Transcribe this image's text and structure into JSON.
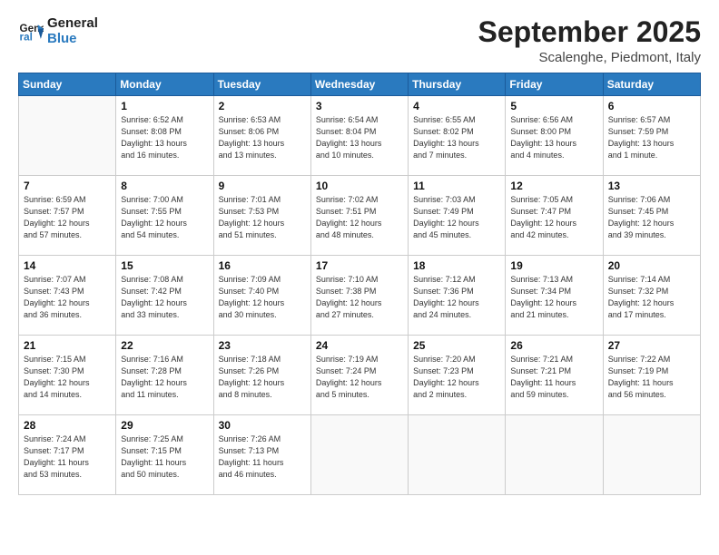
{
  "logo": {
    "line1": "General",
    "line2": "Blue"
  },
  "title": "September 2025",
  "location": "Scalenghe, Piedmont, Italy",
  "days_header": [
    "Sunday",
    "Monday",
    "Tuesday",
    "Wednesday",
    "Thursday",
    "Friday",
    "Saturday"
  ],
  "weeks": [
    [
      {
        "day": "",
        "info": ""
      },
      {
        "day": "1",
        "info": "Sunrise: 6:52 AM\nSunset: 8:08 PM\nDaylight: 13 hours\nand 16 minutes."
      },
      {
        "day": "2",
        "info": "Sunrise: 6:53 AM\nSunset: 8:06 PM\nDaylight: 13 hours\nand 13 minutes."
      },
      {
        "day": "3",
        "info": "Sunrise: 6:54 AM\nSunset: 8:04 PM\nDaylight: 13 hours\nand 10 minutes."
      },
      {
        "day": "4",
        "info": "Sunrise: 6:55 AM\nSunset: 8:02 PM\nDaylight: 13 hours\nand 7 minutes."
      },
      {
        "day": "5",
        "info": "Sunrise: 6:56 AM\nSunset: 8:00 PM\nDaylight: 13 hours\nand 4 minutes."
      },
      {
        "day": "6",
        "info": "Sunrise: 6:57 AM\nSunset: 7:59 PM\nDaylight: 13 hours\nand 1 minute."
      }
    ],
    [
      {
        "day": "7",
        "info": "Sunrise: 6:59 AM\nSunset: 7:57 PM\nDaylight: 12 hours\nand 57 minutes."
      },
      {
        "day": "8",
        "info": "Sunrise: 7:00 AM\nSunset: 7:55 PM\nDaylight: 12 hours\nand 54 minutes."
      },
      {
        "day": "9",
        "info": "Sunrise: 7:01 AM\nSunset: 7:53 PM\nDaylight: 12 hours\nand 51 minutes."
      },
      {
        "day": "10",
        "info": "Sunrise: 7:02 AM\nSunset: 7:51 PM\nDaylight: 12 hours\nand 48 minutes."
      },
      {
        "day": "11",
        "info": "Sunrise: 7:03 AM\nSunset: 7:49 PM\nDaylight: 12 hours\nand 45 minutes."
      },
      {
        "day": "12",
        "info": "Sunrise: 7:05 AM\nSunset: 7:47 PM\nDaylight: 12 hours\nand 42 minutes."
      },
      {
        "day": "13",
        "info": "Sunrise: 7:06 AM\nSunset: 7:45 PM\nDaylight: 12 hours\nand 39 minutes."
      }
    ],
    [
      {
        "day": "14",
        "info": "Sunrise: 7:07 AM\nSunset: 7:43 PM\nDaylight: 12 hours\nand 36 minutes."
      },
      {
        "day": "15",
        "info": "Sunrise: 7:08 AM\nSunset: 7:42 PM\nDaylight: 12 hours\nand 33 minutes."
      },
      {
        "day": "16",
        "info": "Sunrise: 7:09 AM\nSunset: 7:40 PM\nDaylight: 12 hours\nand 30 minutes."
      },
      {
        "day": "17",
        "info": "Sunrise: 7:10 AM\nSunset: 7:38 PM\nDaylight: 12 hours\nand 27 minutes."
      },
      {
        "day": "18",
        "info": "Sunrise: 7:12 AM\nSunset: 7:36 PM\nDaylight: 12 hours\nand 24 minutes."
      },
      {
        "day": "19",
        "info": "Sunrise: 7:13 AM\nSunset: 7:34 PM\nDaylight: 12 hours\nand 21 minutes."
      },
      {
        "day": "20",
        "info": "Sunrise: 7:14 AM\nSunset: 7:32 PM\nDaylight: 12 hours\nand 17 minutes."
      }
    ],
    [
      {
        "day": "21",
        "info": "Sunrise: 7:15 AM\nSunset: 7:30 PM\nDaylight: 12 hours\nand 14 minutes."
      },
      {
        "day": "22",
        "info": "Sunrise: 7:16 AM\nSunset: 7:28 PM\nDaylight: 12 hours\nand 11 minutes."
      },
      {
        "day": "23",
        "info": "Sunrise: 7:18 AM\nSunset: 7:26 PM\nDaylight: 12 hours\nand 8 minutes."
      },
      {
        "day": "24",
        "info": "Sunrise: 7:19 AM\nSunset: 7:24 PM\nDaylight: 12 hours\nand 5 minutes."
      },
      {
        "day": "25",
        "info": "Sunrise: 7:20 AM\nSunset: 7:23 PM\nDaylight: 12 hours\nand 2 minutes."
      },
      {
        "day": "26",
        "info": "Sunrise: 7:21 AM\nSunset: 7:21 PM\nDaylight: 11 hours\nand 59 minutes."
      },
      {
        "day": "27",
        "info": "Sunrise: 7:22 AM\nSunset: 7:19 PM\nDaylight: 11 hours\nand 56 minutes."
      }
    ],
    [
      {
        "day": "28",
        "info": "Sunrise: 7:24 AM\nSunset: 7:17 PM\nDaylight: 11 hours\nand 53 minutes."
      },
      {
        "day": "29",
        "info": "Sunrise: 7:25 AM\nSunset: 7:15 PM\nDaylight: 11 hours\nand 50 minutes."
      },
      {
        "day": "30",
        "info": "Sunrise: 7:26 AM\nSunset: 7:13 PM\nDaylight: 11 hours\nand 46 minutes."
      },
      {
        "day": "",
        "info": ""
      },
      {
        "day": "",
        "info": ""
      },
      {
        "day": "",
        "info": ""
      },
      {
        "day": "",
        "info": ""
      }
    ]
  ]
}
